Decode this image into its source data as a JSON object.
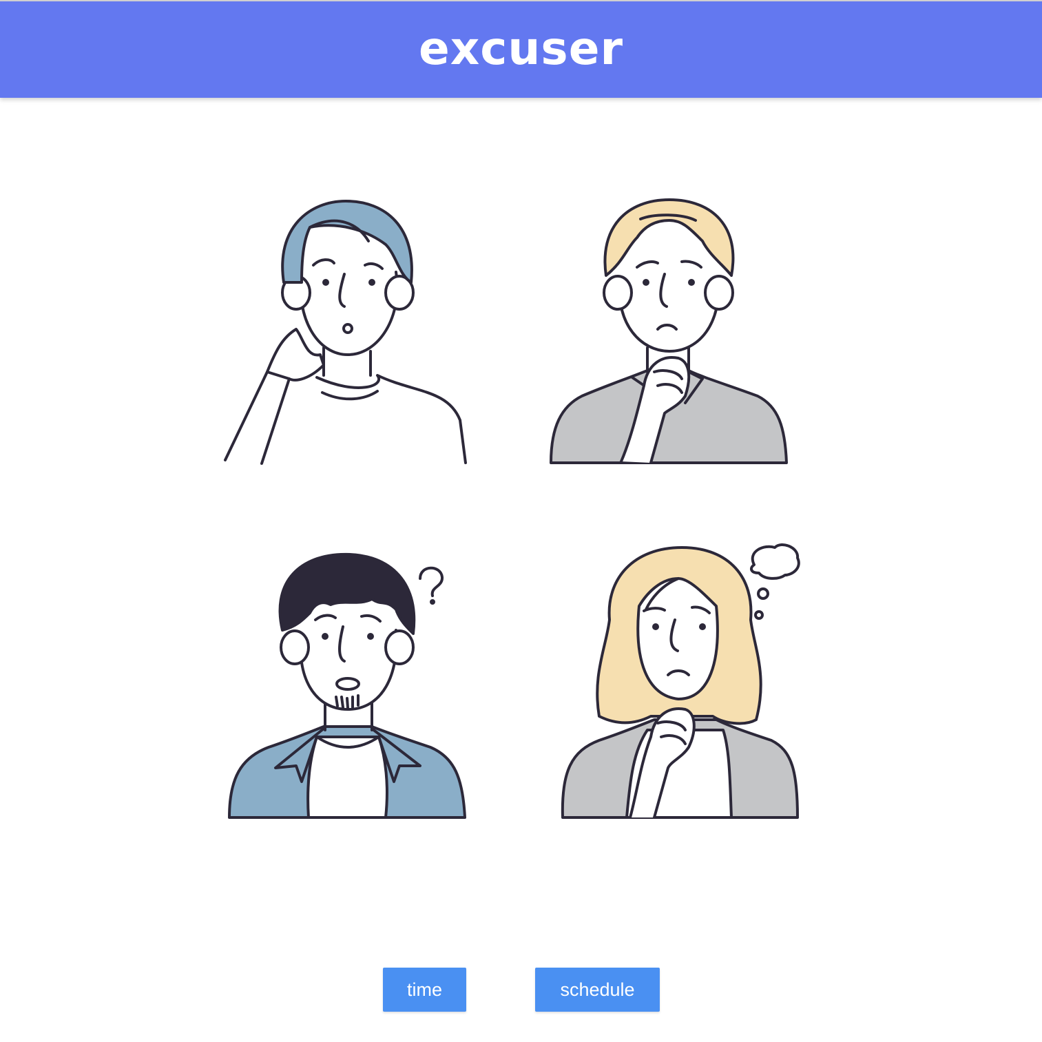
{
  "app": {
    "title": "excuser"
  },
  "illustration": {
    "figures": [
      {
        "name": "thinking-man-blue-hair",
        "hair": "#8aaec8",
        "shirt": "#ffffff"
      },
      {
        "name": "worried-man-blond-hair",
        "hair": "#f6dfb0",
        "shirt": "#c4c5c7"
      },
      {
        "name": "confused-man-dark-hair",
        "hair": "#2c2839",
        "shirt": "#8aaec8",
        "mark": "?"
      },
      {
        "name": "worried-woman-blond-hair",
        "hair": "#f6dfb0",
        "shirt": "#c4c5c7"
      }
    ]
  },
  "buttons": {
    "time_label": "time",
    "schedule_label": "schedule"
  },
  "colors": {
    "header": "#6378f0",
    "button": "#4a90f2",
    "outline": "#2c2839"
  }
}
